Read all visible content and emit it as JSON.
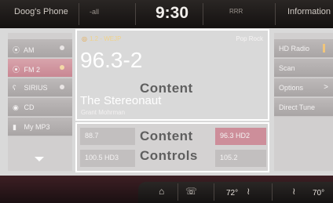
{
  "status_bar": {
    "phone_label": "Doog's Phone",
    "signal_text": "-all",
    "time": "9:30",
    "mid_text": "RRR",
    "info_label": "Information"
  },
  "sources": [
    {
      "icon": "AM-icon",
      "label": "AM",
      "active": false
    },
    {
      "icon": "FM-icon",
      "label": "FM 2",
      "active": true
    },
    {
      "icon": "sirius-icon",
      "label": "SIRIUS",
      "active": false
    },
    {
      "icon": "cd-icon",
      "label": "CD",
      "active": false
    },
    {
      "icon": "mp3-icon",
      "label": "My MP3",
      "active": false
    }
  ],
  "now_playing": {
    "station_id": "1.2 - WEJP",
    "genre": "Pop Rock",
    "frequency": "96.3-2",
    "song": "The Stereonaut",
    "artist": "Grant Mohrman"
  },
  "overlay": {
    "content_label": "Content",
    "controls_label_line1": "Content",
    "controls_label_line2": "Controls"
  },
  "presets": [
    {
      "label": "88.7",
      "active": false
    },
    {
      "label": "96.3 HD2",
      "active": true
    },
    {
      "label": "100.5 HD3",
      "active": false
    },
    {
      "label": "105.2",
      "active": false
    }
  ],
  "options": [
    {
      "label": "HD Radio"
    },
    {
      "label": "Scan"
    },
    {
      "label": "Options",
      "arrow": ">"
    },
    {
      "label": "Direct Tune"
    }
  ],
  "bottom_bar": {
    "temp_left": "72°",
    "temp_right": "70°"
  },
  "colors": {
    "accent_fm": "#c98793",
    "content_border": "#ffffff",
    "time_text": "#f2efec"
  }
}
